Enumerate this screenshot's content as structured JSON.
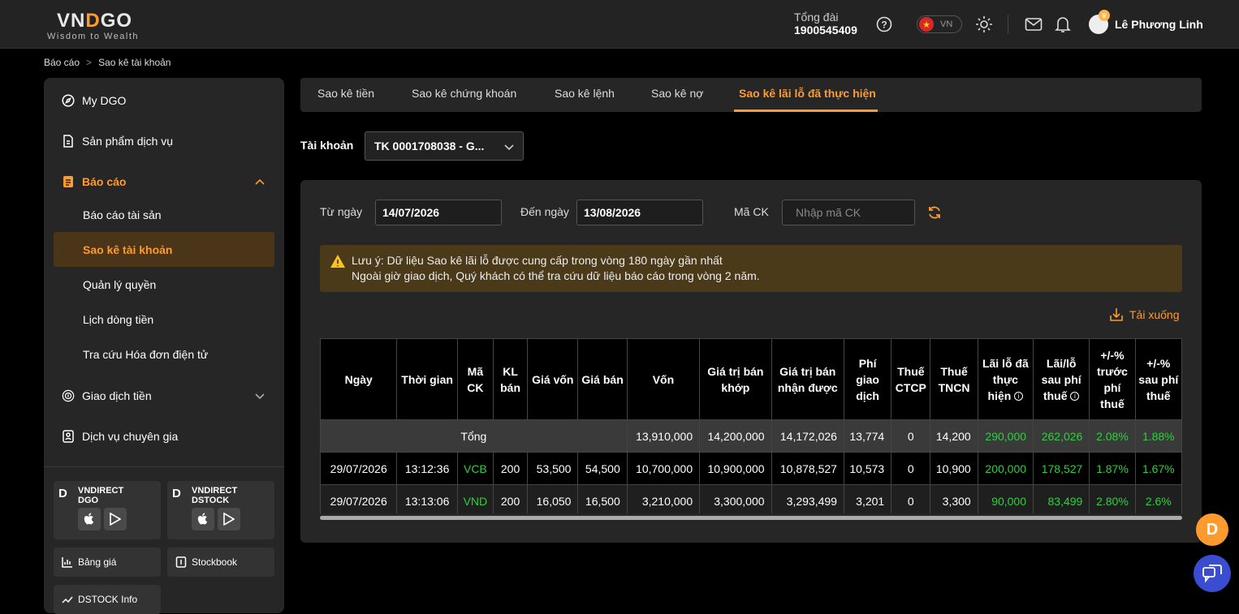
{
  "brand": {
    "logo_text_a": "VN",
    "logo_text_b": "D",
    "logo_text_c": "GO",
    "tagline": "Wisdom to Wealth",
    "accent": "#ff9a2e"
  },
  "header": {
    "hotline_label": "Tổng đài",
    "hotline_number": "1900545409",
    "language": "VN",
    "user_name": "Lê Phương Linh"
  },
  "breadcrumb": {
    "parent": "Báo cáo",
    "current": "Sao kê tài khoản"
  },
  "sidebar": {
    "items": [
      {
        "label": "My DGO",
        "icon": "compass-icon"
      },
      {
        "label": "Sản phẩm dịch vụ",
        "icon": "document-icon"
      },
      {
        "label": "Báo cáo",
        "icon": "report-icon"
      },
      {
        "label": "Giao dịch tiền",
        "icon": "money-icon"
      },
      {
        "label": "Dịch vụ chuyên gia",
        "icon": "expert-icon"
      }
    ],
    "subitems": [
      "Báo cáo tài sản",
      "Sao kê tài khoản",
      "Quản lý quyền",
      "Lịch dòng tiền",
      "Tra cứu Hóa đơn điện tử"
    ],
    "apps": [
      {
        "title_line1": "VNDIRECT",
        "title_line2": "DGO"
      },
      {
        "title_line1": "VNDIRECT",
        "title_line2": "DSTOCK"
      }
    ],
    "tools": [
      "Bảng giá",
      "Stockbook",
      "DSTOCK Info"
    ]
  },
  "tabs": [
    "Sao kê tiền",
    "Sao kê chứng khoán",
    "Sao kê lệnh",
    "Sao kê nợ",
    "Sao kê lãi lỗ đã thực hiện"
  ],
  "account": {
    "label": "Tài khoản",
    "value": "TK 0001708038 - G..."
  },
  "filters": {
    "from_label": "Từ ngày",
    "from_value": "14/07/2026",
    "to_label": "Đến ngày",
    "to_value": "13/08/2026",
    "symbol_label": "Mã CK",
    "symbol_placeholder": "Nhập mã CK"
  },
  "notice": {
    "line1": "Lưu ý: Dữ liệu Sao kê lãi lỗ được cung cấp trong vòng 180 ngày gần nhất",
    "line2": "Ngoài giờ giao dịch, Quý khách có thể tra cứu dữ liệu báo cáo trong vòng 2 năm."
  },
  "download_label": "Tải xuống",
  "table": {
    "headers": [
      "Ngày",
      "Thời gian",
      "Mã CK",
      "KL bán",
      "Giá vốn",
      "Giá bán",
      "Vốn",
      "Giá trị bán khớp",
      "Giá trị bán nhận được",
      "Phí giao dịch",
      "Thuế CTCP",
      "Thuế TNCN",
      "Lãi lỗ đã thực hiện",
      "Lãi/lỗ sau phí thuế",
      "+/-% trước phí thuế",
      "+/-% sau phí thuế"
    ],
    "total": {
      "label": "Tổng",
      "von": "13,910,000",
      "gt_khop": "14,200,000",
      "gt_nhan": "14,172,026",
      "phi": "13,774",
      "ctcp": "0",
      "tncn": "14,200",
      "lai": "290,000",
      "lai_sau": "262,026",
      "pct_truoc": "2.08%",
      "pct_sau": "1.88%"
    },
    "rows": [
      [
        "29/07/2026",
        "13:12:36",
        "VCB",
        "200",
        "53,500",
        "54,500",
        "10,700,000",
        "10,900,000",
        "10,878,527",
        "10,573",
        "0",
        "10,900",
        "200,000",
        "178,527",
        "1.87%",
        "1.67%"
      ],
      [
        "29/07/2026",
        "13:13:06",
        "VND",
        "200",
        "16,050",
        "16,500",
        "3,210,000",
        "3,300,000",
        "3,293,499",
        "3,201",
        "0",
        "3,300",
        "90,000",
        "83,499",
        "2.80%",
        "2.6%"
      ]
    ]
  }
}
